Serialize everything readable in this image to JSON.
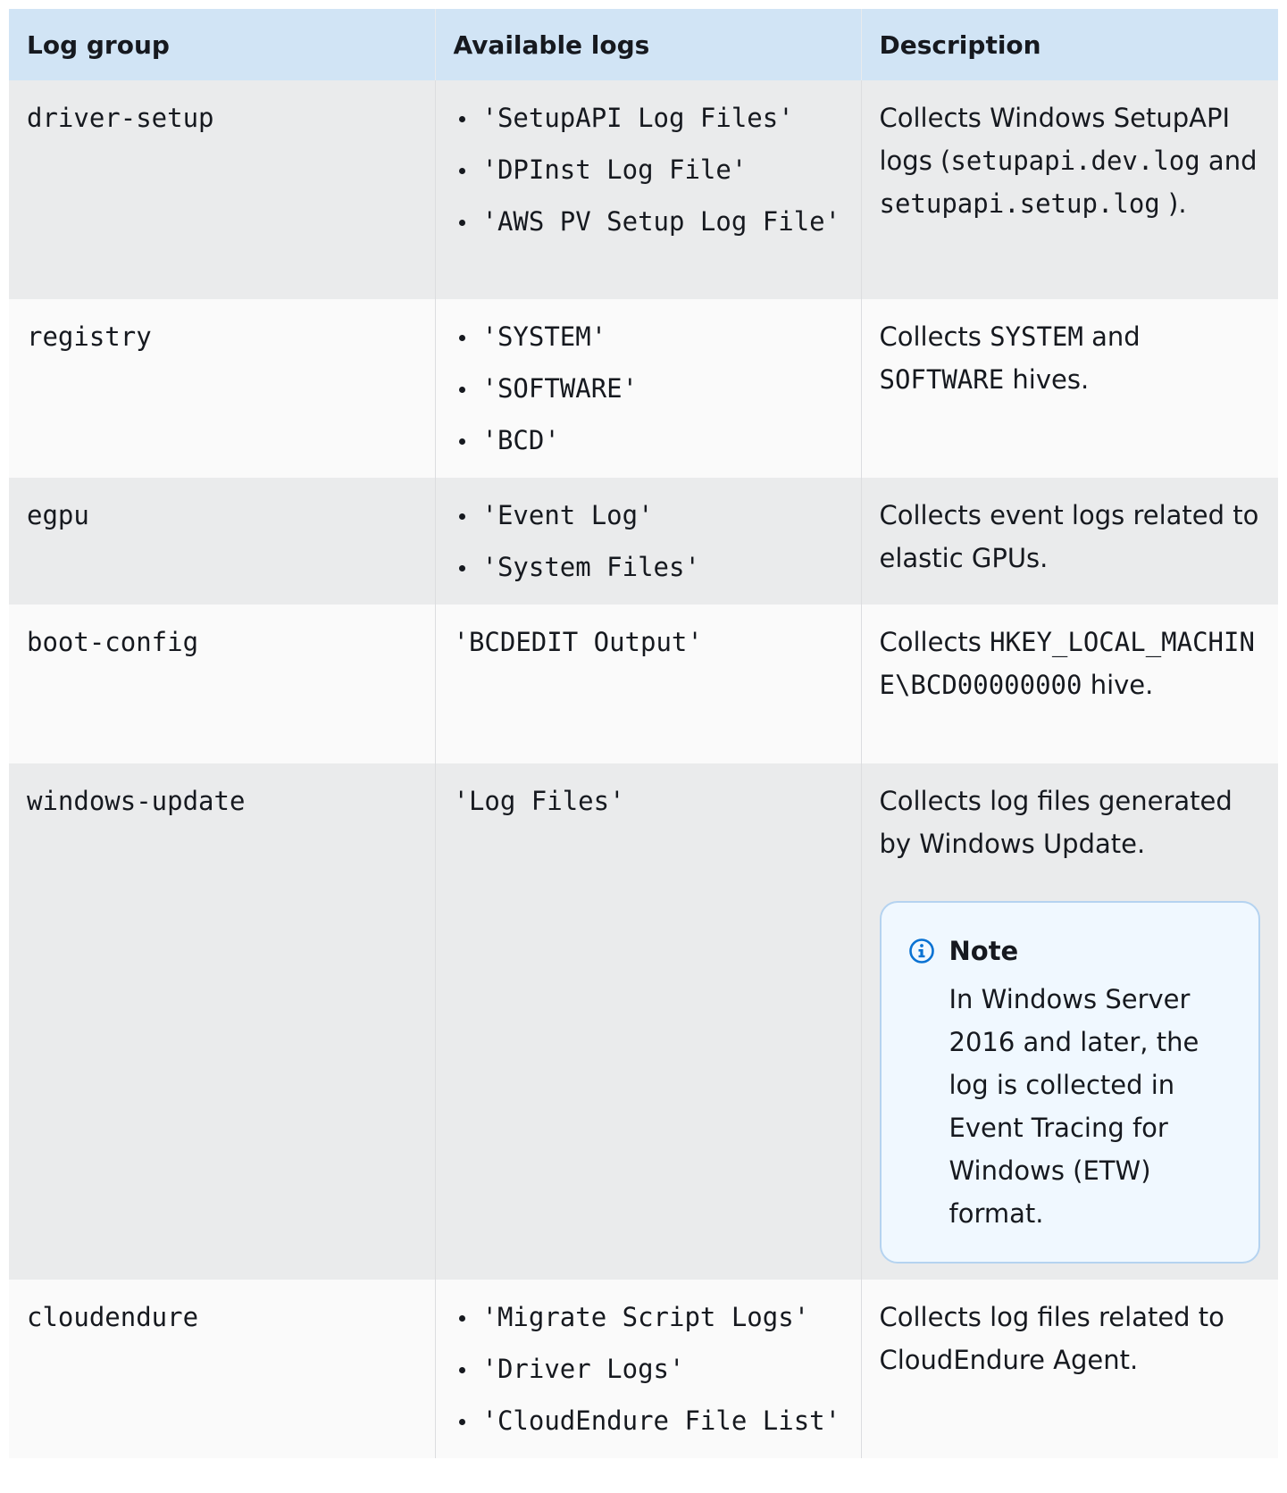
{
  "table": {
    "headers": [
      "Log group",
      "Available logs",
      "Description"
    ],
    "rows": [
      {
        "group": "driver-setup",
        "logs": [
          "'SetupAPI Log Files'",
          "'DPInst Log File'",
          "'AWS PV Setup Log File'"
        ],
        "desc_parts": [
          "Collects Windows SetupAPI logs (",
          "setupapi.dev.log",
          " and ",
          "setupapi.setup.log",
          " )."
        ]
      },
      {
        "group": "registry",
        "logs": [
          "'SYSTEM'",
          "'SOFTWARE'",
          "'BCD'"
        ],
        "desc_parts": [
          "Collects ",
          "SYSTEM",
          " and ",
          "SOFTWARE",
          " hives."
        ]
      },
      {
        "group": "egpu",
        "logs": [
          "'Event Log'",
          "'System Files'"
        ],
        "desc": "Collects event logs related to elastic GPUs."
      },
      {
        "group": "boot-config",
        "logs_plain": "'BCDEDIT Output'",
        "desc_parts": [
          "Collects ",
          "HKEY_LOCAL_MACHINE\\BCD00000000",
          " hive."
        ]
      },
      {
        "group": "windows-update",
        "logs_plain": "'Log Files'",
        "desc": "Collects log files generated by Windows Update.",
        "note": {
          "icon": "info-icon",
          "title": "Note",
          "body": "In Windows Server 2016 and later, the log is collected in Event Tracing for Windows (ETW) format."
        }
      },
      {
        "group": "cloudendure",
        "logs": [
          "'Migrate Script Logs'",
          "'Driver Logs'",
          "'CloudEndure File List'"
        ],
        "desc": "Collects log files related to CloudEndure Agent."
      }
    ]
  }
}
